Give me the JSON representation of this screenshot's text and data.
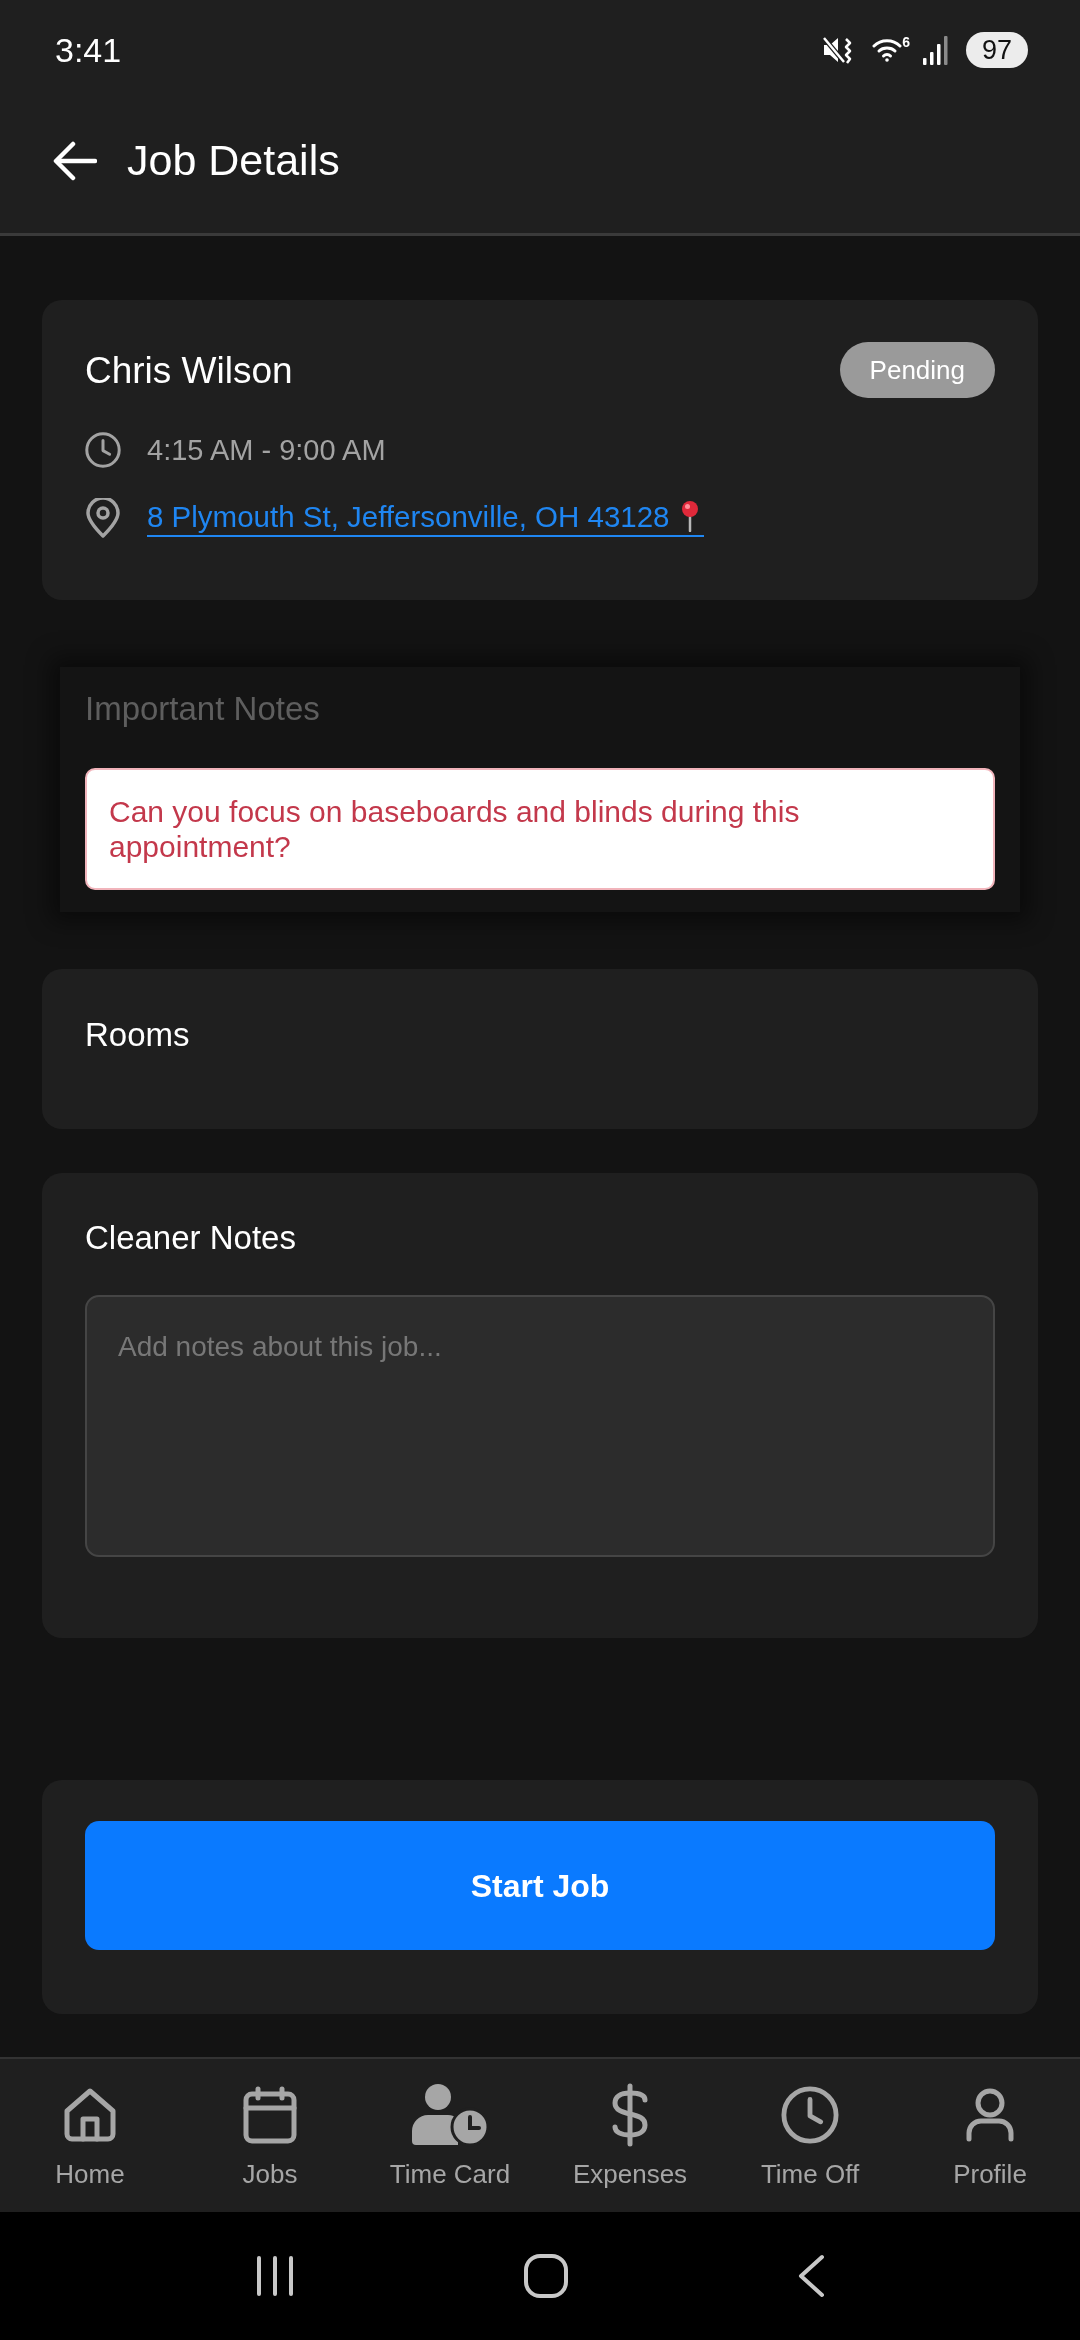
{
  "status_bar": {
    "time": "3:41",
    "wifi_badge": "6",
    "battery": "97"
  },
  "header": {
    "title": "Job Details"
  },
  "job": {
    "client": "Chris Wilson",
    "status": "Pending",
    "time": "4:15 AM - 9:00 AM",
    "address": "8 Plymouth St, Jeffersonville, OH 43128"
  },
  "important_notes": {
    "title": "Important Notes",
    "note": "Can you focus on baseboards and blinds during this appointment?"
  },
  "rooms": {
    "title": "Rooms"
  },
  "cleaner_notes": {
    "title": "Cleaner Notes",
    "placeholder": "Add notes about this job..."
  },
  "actions": {
    "primary_button": "Start Job"
  },
  "bottom_nav": [
    {
      "label": "Home",
      "kind": "home",
      "selected": false
    },
    {
      "label": "Jobs",
      "kind": "jobs",
      "selected": false
    },
    {
      "label": "Time Card",
      "kind": "time_card",
      "selected": false
    },
    {
      "label": "Expenses",
      "kind": "expenses",
      "selected": false
    },
    {
      "label": "Time Off",
      "kind": "time_off",
      "selected": false
    },
    {
      "label": "Profile",
      "kind": "profile",
      "selected": false
    }
  ]
}
